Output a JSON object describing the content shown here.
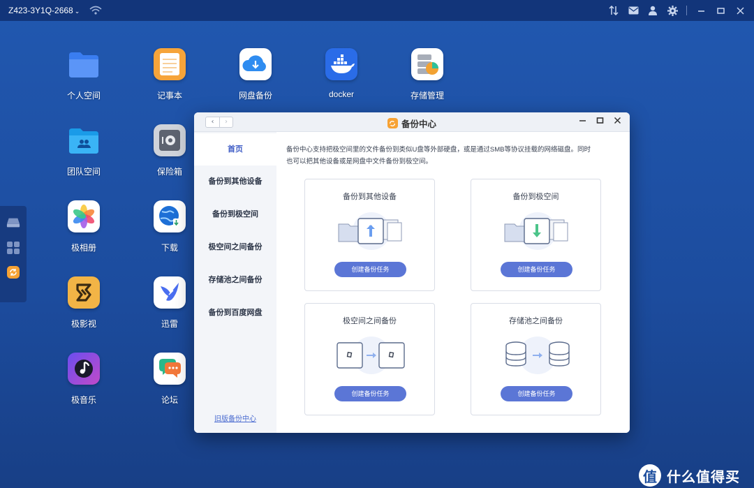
{
  "topbar": {
    "device_name": "Z423-3Y1Q-2668",
    "chevron": "⌄"
  },
  "desktop_apps": [
    {
      "label": "个人空间",
      "icon": "folder-icon"
    },
    {
      "label": "记事本",
      "icon": "notepad-icon"
    },
    {
      "label": "网盘备份",
      "icon": "cloud-download-icon"
    },
    {
      "label": "docker",
      "icon": "docker-icon"
    },
    {
      "label": "存储管理",
      "icon": "storage-icon"
    },
    {
      "label": "团队空间",
      "icon": "team-folder-icon"
    },
    {
      "label": "保险箱",
      "icon": "safe-icon"
    },
    {
      "label": "极相册",
      "icon": "photos-icon"
    },
    {
      "label": "下载",
      "icon": "download-globe-icon"
    },
    {
      "label": "极影视",
      "icon": "video-icon"
    },
    {
      "label": "迅雷",
      "icon": "thunder-bird-icon"
    },
    {
      "label": "极音乐",
      "icon": "music-icon"
    },
    {
      "label": "论坛",
      "icon": "forum-icon"
    }
  ],
  "window": {
    "title": "备份中心",
    "nav_back": "‹",
    "nav_forward": "›",
    "sidebar": [
      {
        "label": "首页"
      },
      {
        "label": "备份到其他设备"
      },
      {
        "label": "备份到极空间"
      },
      {
        "label": "极空间之间备份"
      },
      {
        "label": "存储池之间备份"
      },
      {
        "label": "备份到百度网盘"
      }
    ],
    "old_version_link": "旧版备份中心",
    "intro_line1": "备份中心支持把极空间里的文件备份到类似U盘等外部硬盘，或是通过SMB等协议挂载的网络磁盘。同时",
    "intro_line2": "也可以把其他设备或是网盘中文件备份到极空间。",
    "cards": [
      {
        "title": "备份到其他设备",
        "button": "创建备份任务"
      },
      {
        "title": "备份到极空间",
        "button": "创建备份任务"
      },
      {
        "title": "极空间之间备份",
        "button": "创建备份任务"
      },
      {
        "title": "存储池之间备份",
        "button": "创建备份任务"
      }
    ]
  },
  "watermark": {
    "text": "什么值得买",
    "logo": "值"
  },
  "colors": {
    "accent": "#5b76d6",
    "active_nav": "#3f5dc6",
    "desktop": "#1d4e9e",
    "topbar": "#12357a"
  }
}
